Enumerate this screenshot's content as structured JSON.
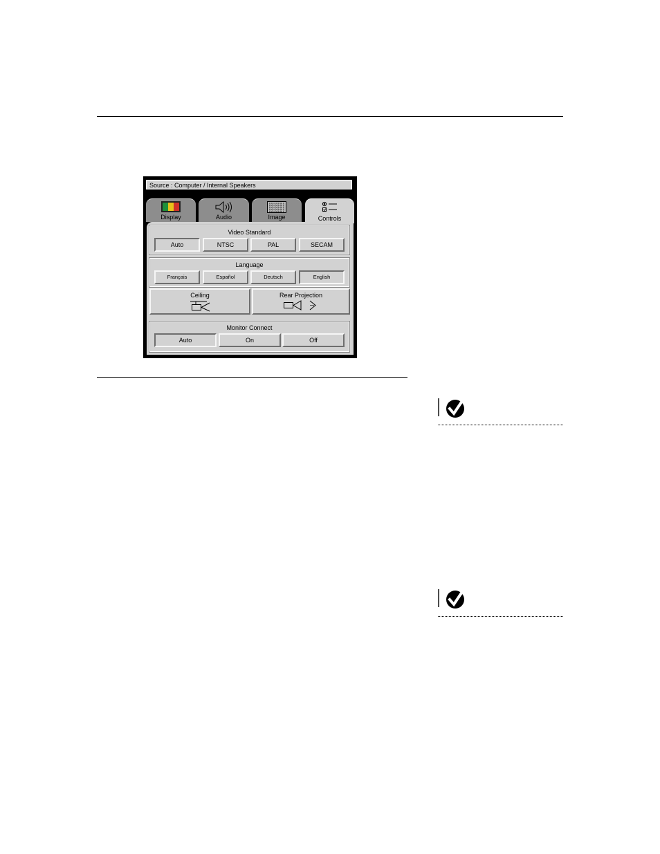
{
  "menu": {
    "source": "Source : Computer / Internal Speakers",
    "tabs": [
      {
        "label": "Display",
        "icon": "display-color-bars-icon"
      },
      {
        "label": "Audio",
        "icon": "speaker-icon"
      },
      {
        "label": "Image",
        "icon": "image-pattern-icon"
      },
      {
        "label": "Controls",
        "icon": "controls-icon",
        "active": true
      }
    ],
    "video_standard": {
      "title": "Video Standard",
      "options": [
        "Auto",
        "NTSC",
        "PAL",
        "SECAM"
      ],
      "selected": "Auto"
    },
    "language": {
      "title": "Language",
      "options": [
        "Français",
        "Español",
        "Deutsch",
        "English"
      ],
      "selected": "English"
    },
    "ceiling": {
      "label": "Ceiling",
      "icon": "ceiling-projector-icon"
    },
    "rear_projection": {
      "label": "Rear Projection",
      "icon": "rear-projection-icon"
    },
    "monitor_connect": {
      "title": "Monitor Connect",
      "options": [
        "Auto",
        "On",
        "Off"
      ],
      "selected": "Auto"
    }
  },
  "notes": [
    {
      "icon": "checkmark-note-icon"
    },
    {
      "icon": "checkmark-note-icon"
    }
  ],
  "colors": {
    "menu_gray": "#d2d2d2",
    "tab_gray": "#8d8d8d",
    "display_icon": [
      "#1e8f3a",
      "#e8c21a",
      "#d0302a"
    ]
  }
}
